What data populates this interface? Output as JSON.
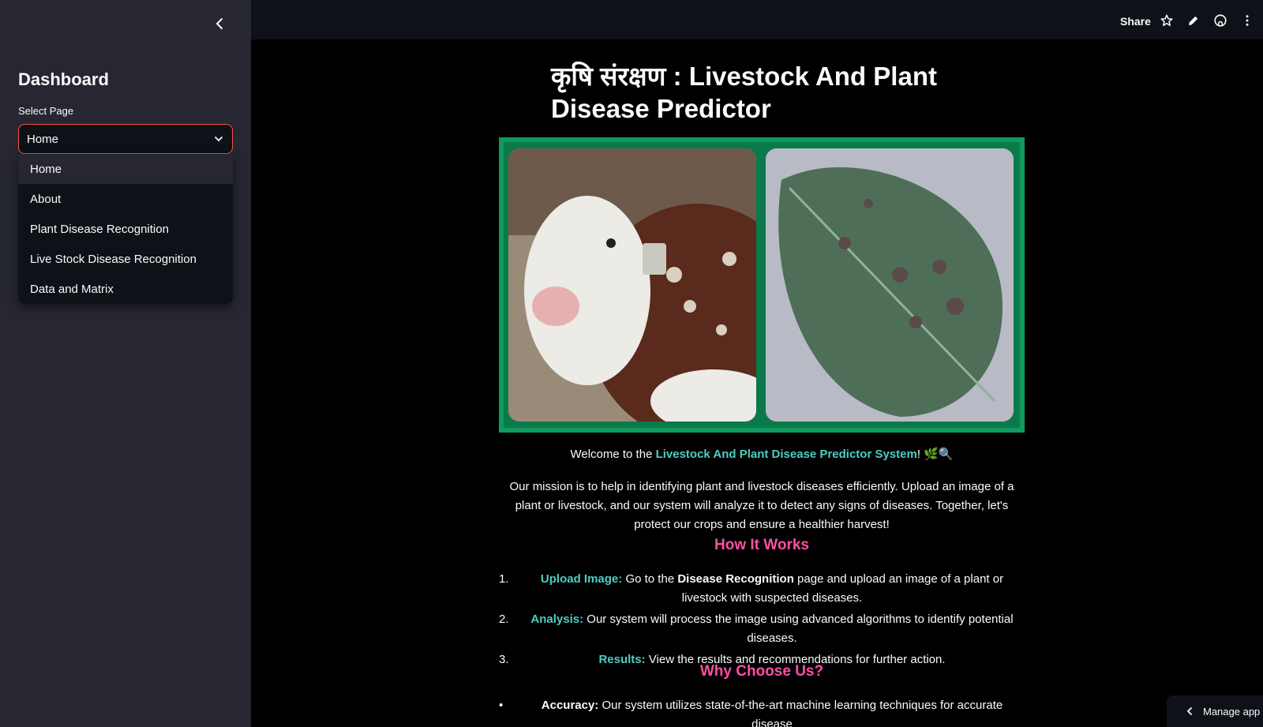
{
  "sidebar": {
    "title": "Dashboard",
    "select_label": "Select Page",
    "selected_value": "Home",
    "options": [
      "Home",
      "About",
      "Plant Disease Recognition",
      "Live Stock Disease Recognition",
      "Data and Matrix"
    ]
  },
  "header": {
    "share_label": "Share"
  },
  "main": {
    "title": "कृषि संरक्षण : Livestock And Plant Disease Predictor",
    "welcome_prefix": "Welcome to the ",
    "welcome_highlight": "Livestock And Plant Disease Predictor System",
    "welcome_suffix": "! 🌿🔍",
    "mission": "Our mission is to help in identifying plant and livestock diseases efficiently. Upload an image of a plant or livestock, and our system will analyze it to detect any signs of diseases. Together, let's protect our crops and ensure a healthier harvest!",
    "how_heading": "How It Works",
    "steps": [
      {
        "num": "1.",
        "label": "Upload Image:",
        "text_a": " Go to the ",
        "bold": "Disease Recognition",
        "text_b": " page and upload an image of a plant or livestock with suspected diseases."
      },
      {
        "num": "2.",
        "label": "Analysis:",
        "text_a": " Our system will process the image using advanced algorithms to identify potential diseases."
      },
      {
        "num": "3.",
        "label": "Results:",
        "text_a": " View the results and recommendations for further action."
      }
    ],
    "why_heading": "Why Choose Us?",
    "bullets": [
      {
        "label": "Accuracy:",
        "text": " Our system utilizes state-of-the-art machine learning techniques for accurate disease"
      }
    ]
  },
  "footer": {
    "manage_label": "Manage app"
  },
  "colors": {
    "accent": "#4ecdc4",
    "heading": "#ff4fa3",
    "select_border": "#ff4b4b"
  }
}
